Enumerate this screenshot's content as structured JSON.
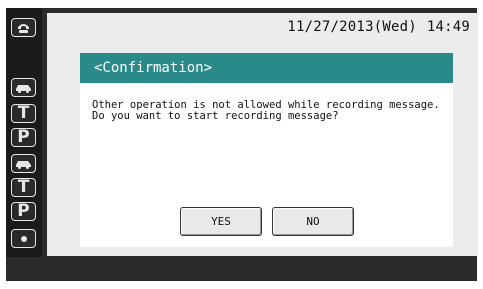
{
  "header": {
    "date": "11/27/2013(Wed)",
    "time": "14:49"
  },
  "sidebar": {
    "items": [
      {
        "icon": "handset-icon"
      },
      {
        "icon": "car-icon"
      },
      {
        "icon": "letter-t-icon",
        "label": "T"
      },
      {
        "icon": "letter-p-icon",
        "label": "P"
      },
      {
        "icon": "car-icon"
      },
      {
        "icon": "letter-t-icon",
        "label": "T"
      },
      {
        "icon": "letter-p-icon",
        "label": "P"
      },
      {
        "icon": "dot-icon"
      }
    ]
  },
  "dialog": {
    "title": "<Confirmation>",
    "message_line1": "Other operation is not allowed while recording message.",
    "message_line2": "Do you want to start recording message?",
    "yes_label": "YES",
    "no_label": "NO"
  },
  "colors": {
    "bezel": "#2b2b2b",
    "screen_bg": "#ececec",
    "dialog_header": "#2a8a8a"
  }
}
